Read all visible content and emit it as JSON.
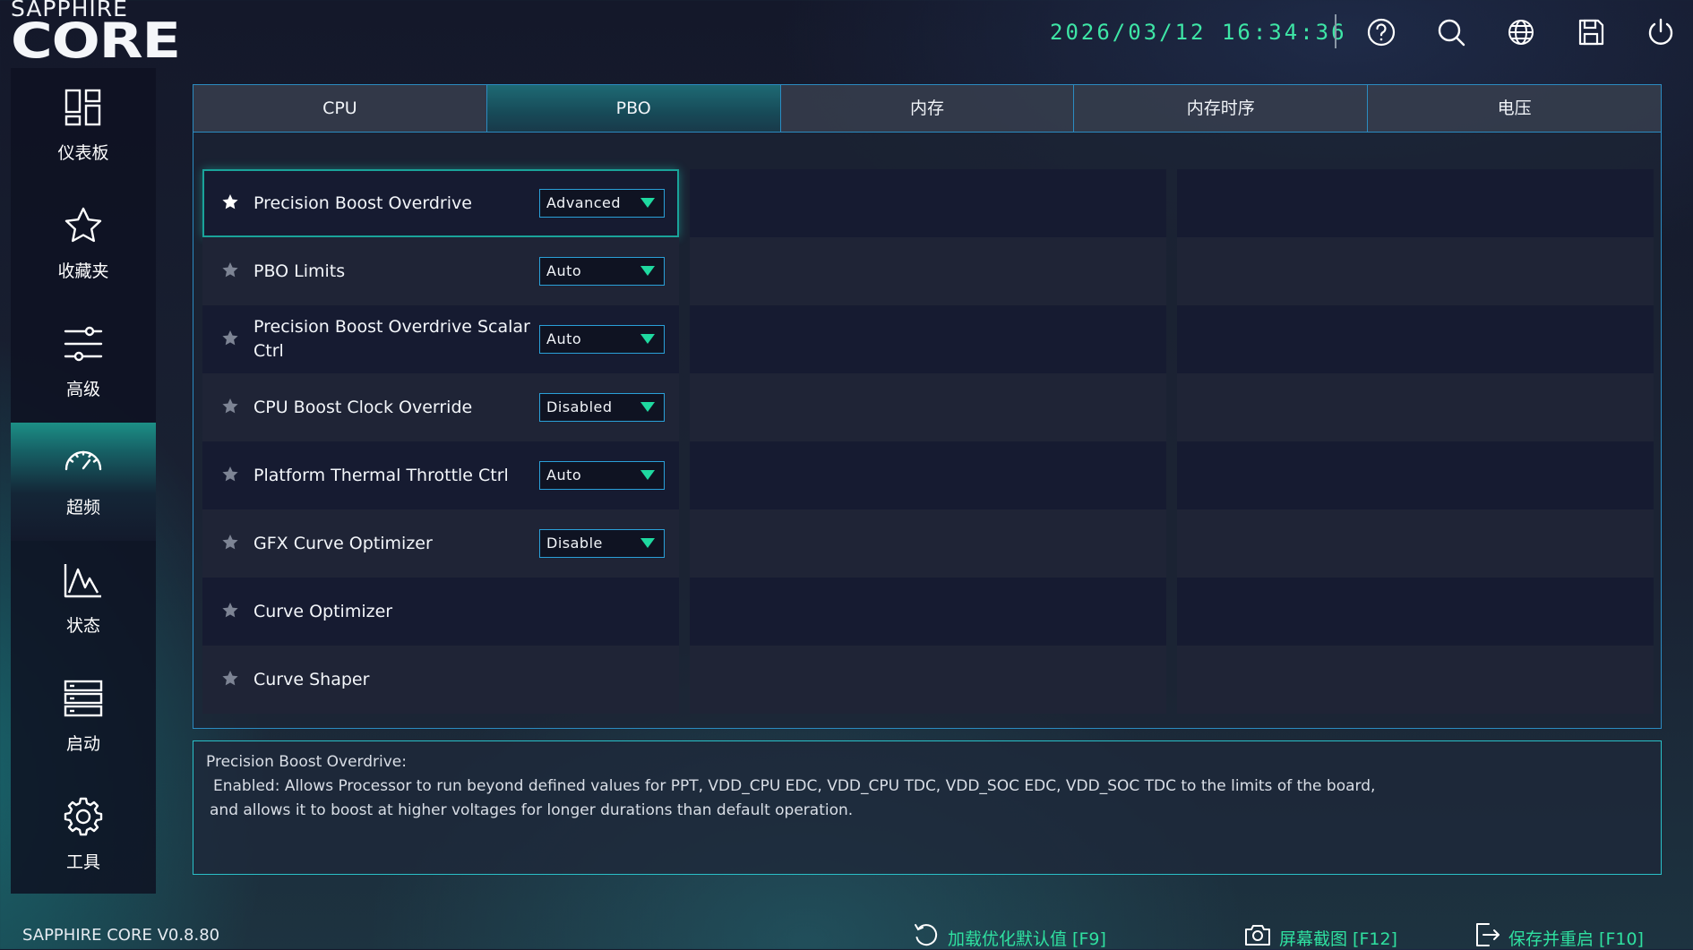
{
  "header": {
    "logo_top": "SAPPHIRE",
    "logo_main": "CORE",
    "datetime": "2026/03/12 16:34:36",
    "icons": [
      "help-icon",
      "search-icon",
      "globe-icon",
      "save-icon",
      "power-icon"
    ]
  },
  "sidebar": {
    "items": [
      {
        "label": "仪表板",
        "icon": "dashboard-icon"
      },
      {
        "label": "收藏夹",
        "icon": "star-icon"
      },
      {
        "label": "高级",
        "icon": "sliders-icon"
      },
      {
        "label": "超频",
        "icon": "speedometer-icon",
        "active": true
      },
      {
        "label": "状态",
        "icon": "chart-icon"
      },
      {
        "label": "启动",
        "icon": "boot-list-icon"
      },
      {
        "label": "工具",
        "icon": "gear-icon"
      }
    ]
  },
  "tabs": [
    {
      "label": "CPU"
    },
    {
      "label": "PBO",
      "active": true
    },
    {
      "label": "内存"
    },
    {
      "label": "内存时序"
    },
    {
      "label": "电压"
    }
  ],
  "settings": [
    {
      "label": "Precision Boost Overdrive",
      "value": "Advanced",
      "selected": true
    },
    {
      "label": "PBO Limits",
      "value": "Auto"
    },
    {
      "label": "Precision Boost Overdrive Scalar Ctrl",
      "value": "Auto"
    },
    {
      "label": "CPU Boost Clock Override",
      "value": "Disabled"
    },
    {
      "label": "Platform Thermal Throttle Ctrl",
      "value": "Auto"
    },
    {
      "label": "GFX Curve Optimizer",
      "value": "Disable"
    },
    {
      "label": "Curve Optimizer",
      "value": null
    },
    {
      "label": "Curve Shaper",
      "value": null
    }
  ],
  "description": {
    "title": "Precision Boost Overdrive:",
    "line1": "Enabled: Allows Processor to run beyond defined values for PPT, VDD_CPU EDC, VDD_CPU TDC, VDD_SOC EDC, VDD_SOC TDC to the limits of the board,",
    "line2": "and allows it to boost at higher voltages for longer durations than default operation."
  },
  "footer": {
    "version": "SAPPHIRE CORE V0.8.80",
    "actions": [
      {
        "label": "加载优化默认值 [F9]",
        "icon": "reload-icon"
      },
      {
        "label": "屏幕截图 [F12]",
        "icon": "camera-icon"
      },
      {
        "label": "保存并重启 [F10]",
        "icon": "exit-icon"
      }
    ]
  },
  "colors": {
    "accent": "#2fe0a0",
    "border": "#2b8bc1",
    "clock": "#3ee6a6"
  }
}
